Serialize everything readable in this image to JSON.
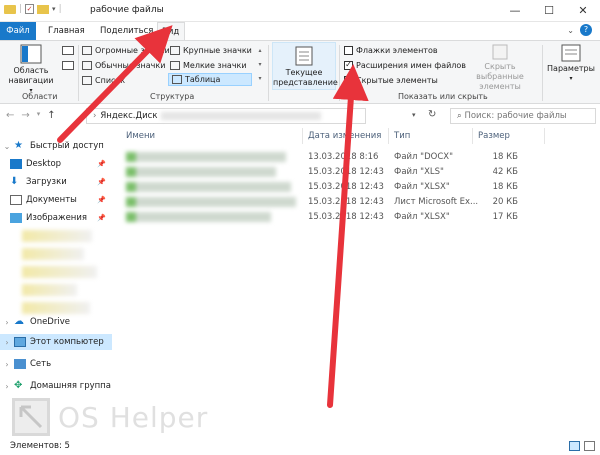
{
  "window": {
    "title": "рабочие файлы",
    "caption_min": "—",
    "caption_max": "☐",
    "caption_close": "✕",
    "help": "?"
  },
  "tabs": [
    {
      "label": "Файл"
    },
    {
      "label": "Главная"
    },
    {
      "label": "Поделиться"
    },
    {
      "label": "Вид"
    }
  ],
  "ribbon": {
    "areas_group": {
      "nav_pane": "Область навигации",
      "label": "Области"
    },
    "layout_group": {
      "huge_icons": "Огромные значки",
      "large_icons": "Крупные значки",
      "normal_icons": "Обычные значки",
      "small_icons": "Мелкие значки",
      "list": "Список",
      "table": "Таблица",
      "label": "Структура"
    },
    "view_group": {
      "current_view": "Текущее представление",
      "label": ""
    },
    "show_group": {
      "item_checkboxes": "Флажки элементов",
      "file_extensions": "Расширения имен файлов",
      "hidden_items": "Скрытые элементы",
      "hide_selected": "Скрыть выбранные элементы",
      "label": "Показать или скрыть"
    },
    "options": "Параметры",
    "checks": {
      "item_checkboxes": false,
      "file_extensions": true,
      "hidden_items": false
    }
  },
  "address": {
    "path": "Яндекс.Диск",
    "search_placeholder": "Поиск: рабочие файлы"
  },
  "sidebar": {
    "quick_access": "Быстрый доступ",
    "items": [
      {
        "label": "Desktop"
      },
      {
        "label": "Загрузки"
      },
      {
        "label": "Документы"
      },
      {
        "label": "Изображения"
      }
    ],
    "onedrive": "OneDrive",
    "this_pc": "Этот компьютер",
    "network": "Сеть",
    "homegroup": "Домашняя группа"
  },
  "columns": {
    "name": "Имени",
    "date": "Дата изменения",
    "type": "Тип",
    "size": "Размер"
  },
  "files": [
    {
      "date": "13.03.2018 8:16",
      "type": "Файл \"DOCX\"",
      "size": "18 КБ"
    },
    {
      "date": "15.03.2018 12:43",
      "type": "Файл \"XLS\"",
      "size": "42 КБ"
    },
    {
      "date": "15.03.2018 12:43",
      "type": "Файл \"XLSX\"",
      "size": "18 КБ"
    },
    {
      "date": "15.03.2018 12:43",
      "type": "Лист Microsoft Ex...",
      "size": "20 КБ"
    },
    {
      "date": "15.03.2018 12:43",
      "type": "Файл \"XLSX\"",
      "size": "17 КБ"
    }
  ],
  "status": {
    "count": "Элементов: 5"
  },
  "watermark": "OS Helper",
  "colors": {
    "accent": "#1979ca",
    "arrow": "#e8333b",
    "selection": "#cce8ff"
  }
}
